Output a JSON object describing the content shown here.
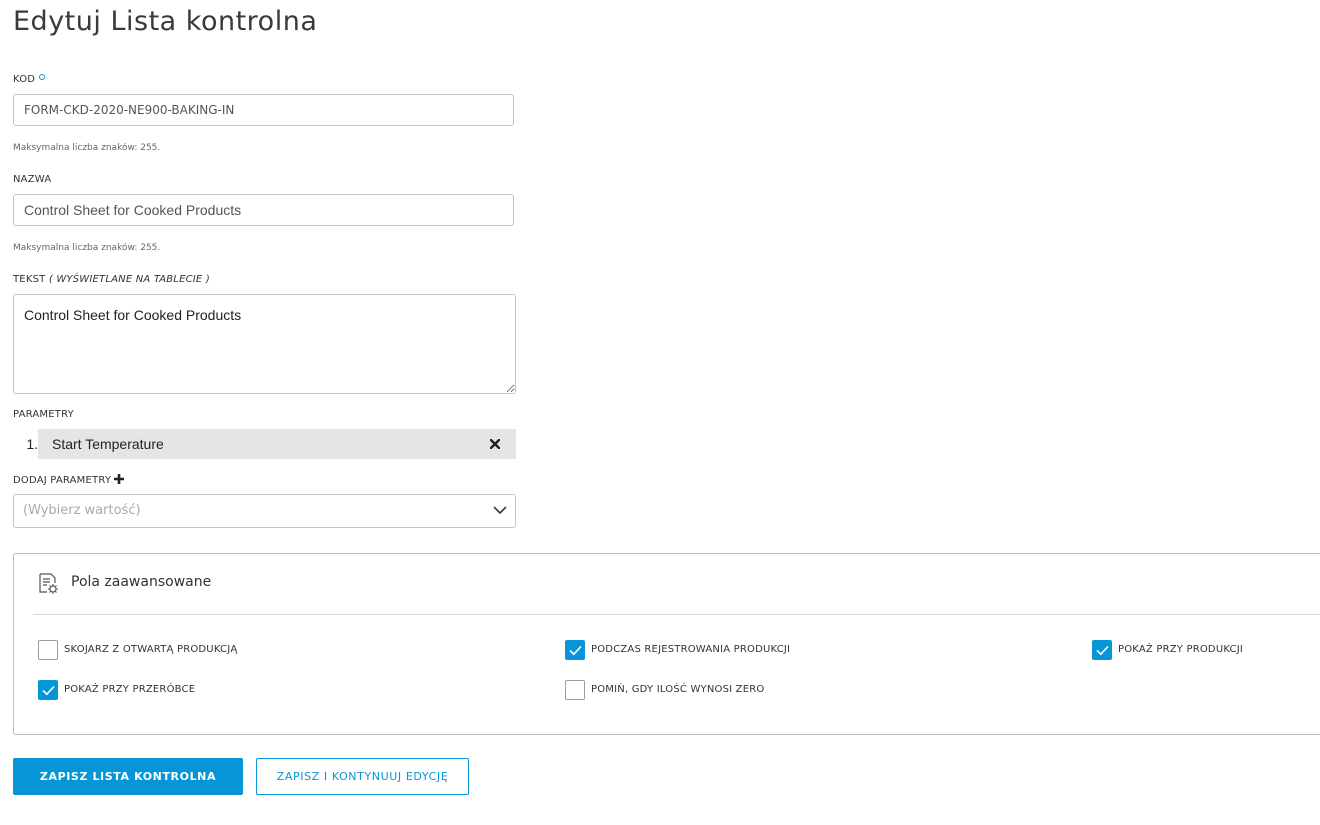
{
  "page": {
    "title": "Edytuj Lista kontrolna"
  },
  "form": {
    "kod": {
      "label": "KOD",
      "value": "FORM-CKD-2020-NE900-BAKING-IN",
      "hint": "Maksymalna liczba znaków: 255."
    },
    "nazwa": {
      "label": "NAZWA",
      "value": "Control Sheet for Cooked Products",
      "hint": "Maksymalna liczba znaków: 255."
    },
    "tekst": {
      "label": "TEKST",
      "label_note": "( WYŚWIETLANE NA TABLECIE )",
      "value": "Control Sheet for Cooked Products"
    },
    "parametry": {
      "label": "PARAMETRY",
      "items": [
        {
          "number": "1.",
          "name": "Start Temperature"
        }
      ]
    },
    "dodaj_parametry": {
      "label": "DODAJ PARAMETRY",
      "placeholder": "(Wybierz wartość)"
    }
  },
  "advanced": {
    "title": "Pola zaawansowane",
    "checkboxes": [
      {
        "label": "SKOJARZ Z OTWARTĄ PRODUKCJĄ",
        "checked": false
      },
      {
        "label": "PODCZAS REJESTROWANIA PRODUKCJI",
        "checked": true
      },
      {
        "label": "POKAŻ PRZY PRODUKCJI",
        "checked": true
      },
      {
        "label": "POKAŻ PRZY PRZERÓBCE",
        "checked": true
      },
      {
        "label": "POMIŃ, GDY ILOŚĆ WYNOSI ZERO",
        "checked": false
      }
    ]
  },
  "actions": {
    "save_label": "ZAPISZ LISTA KONTROLNA",
    "save_continue_label": "ZAPISZ I KONTYNUUJ EDYCJĘ"
  },
  "colors": {
    "accent": "#0696d7",
    "param_bg": "#e5e5e5",
    "border": "#c3c3c3"
  }
}
